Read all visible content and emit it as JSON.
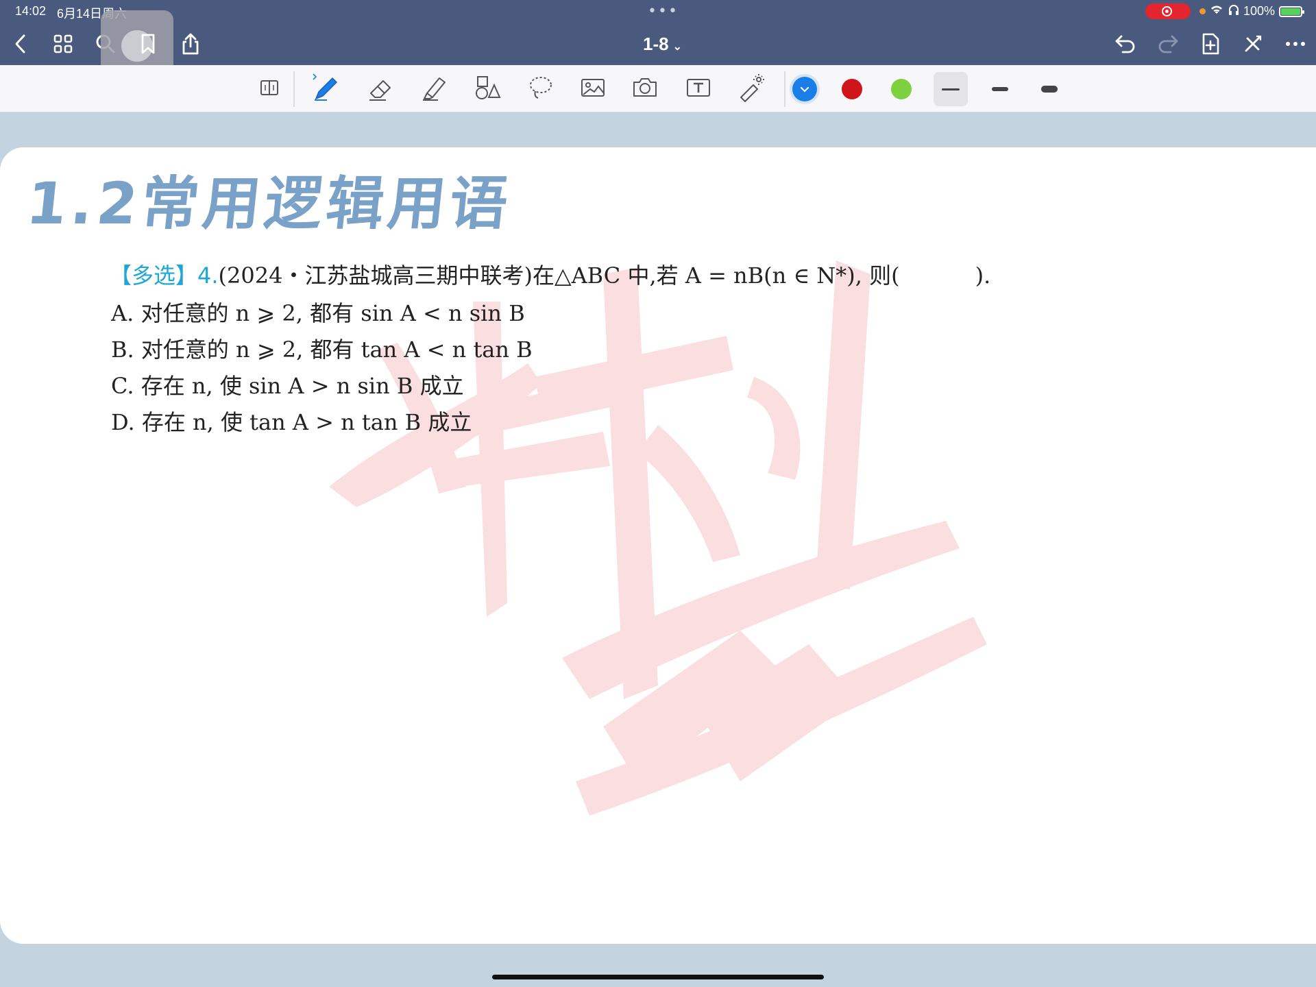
{
  "status_bar": {
    "time": "14:02",
    "date": "6月14日周六",
    "battery": "100%"
  },
  "nav": {
    "page_label": "1-8"
  },
  "toolbar": {
    "icons": [
      "page-layout-icon",
      "pen-icon",
      "eraser-icon",
      "highlighter-icon",
      "shapes-icon",
      "lasso-icon",
      "image-icon",
      "camera-icon",
      "textbox-icon",
      "laser-pointer-icon"
    ],
    "colors": [
      "#1a7ee8",
      "#d0141c",
      "#7ed03f"
    ]
  },
  "document": {
    "section_title": "1.2常用逻辑用语",
    "question": {
      "tag": "【多选】",
      "number": "4.",
      "stem": "(2024・江苏盐城高三期中联考)在△ABC 中,若 A = nB(n ∈ N*), 则(",
      "blank_end": ")."
    },
    "options": [
      "A.  对任意的 n ⩾ 2, 都有 sin A < n sin B",
      "B.  对任意的 n ⩾ 2, 都有 tan A < n tan B",
      "C.  存在 n, 使 sin A > n sin B 成立",
      "D.  存在 n, 使 tan A > n tan B 成立"
    ]
  }
}
